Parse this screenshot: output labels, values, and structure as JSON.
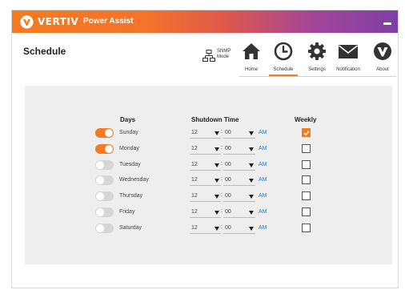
{
  "app": {
    "brand": "VERTIV",
    "title": "Power Assist",
    "brand_color": "#f47b20"
  },
  "page": {
    "title": "Schedule"
  },
  "snmp": {
    "label_line1": "SNMP",
    "label_line2": "Mode",
    "icon": "network-icon"
  },
  "nav": [
    {
      "label": "Home",
      "icon": "home-icon",
      "active": false
    },
    {
      "label": "Schedule",
      "icon": "clock-icon",
      "active": true
    },
    {
      "label": "Settings",
      "icon": "gear-icon",
      "active": false
    },
    {
      "label": "Notification",
      "icon": "envelope-icon",
      "active": false
    },
    {
      "label": "About",
      "icon": "vertiv-logo-icon",
      "active": false
    }
  ],
  "schedule": {
    "headers": {
      "days": "Days",
      "shutdown": "Shutdown Time",
      "weekly": "Weekly"
    },
    "rows": [
      {
        "day": "Sunday",
        "enabled": true,
        "hour": "12",
        "minute": "00",
        "ampm": "AM",
        "weekly": true
      },
      {
        "day": "Monday",
        "enabled": true,
        "hour": "12",
        "minute": "00",
        "ampm": "AM",
        "weekly": false
      },
      {
        "day": "Tuesday",
        "enabled": false,
        "hour": "12",
        "minute": "00",
        "ampm": "AM",
        "weekly": false
      },
      {
        "day": "Wednesday",
        "enabled": false,
        "hour": "12",
        "minute": "00",
        "ampm": "AM",
        "weekly": false
      },
      {
        "day": "Thursday",
        "enabled": false,
        "hour": "12",
        "minute": "00",
        "ampm": "AM",
        "weekly": false
      },
      {
        "day": "Friday",
        "enabled": false,
        "hour": "12",
        "minute": "00",
        "ampm": "AM",
        "weekly": false
      },
      {
        "day": "Saturday",
        "enabled": false,
        "hour": "12",
        "minute": "00",
        "ampm": "AM",
        "weekly": false
      }
    ]
  }
}
